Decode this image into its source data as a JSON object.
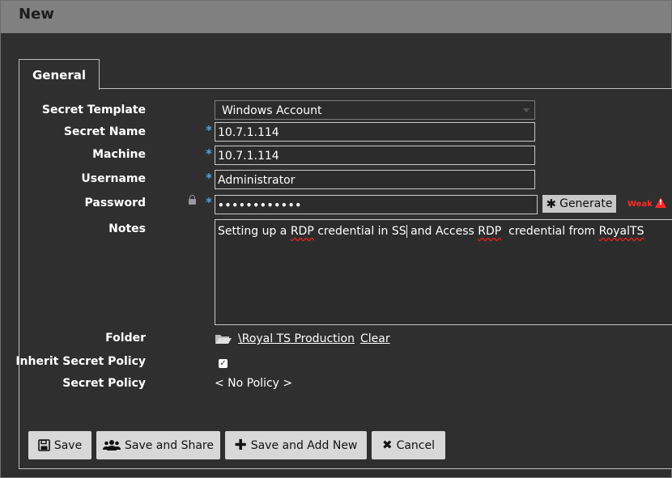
{
  "window": {
    "title": "New"
  },
  "tabs": [
    {
      "label": "General"
    }
  ],
  "form": {
    "secret_template": {
      "label": "Secret Template",
      "value": "Windows Account"
    },
    "secret_name": {
      "label": "Secret Name",
      "value": "10.7.1.114",
      "required": "*"
    },
    "machine": {
      "label": "Machine",
      "value": "10.7.1.114",
      "required": "*"
    },
    "username": {
      "label": "Username",
      "value": "Administrator",
      "required": "*"
    },
    "password": {
      "label": "Password",
      "value": "••••••••••••",
      "required": "*",
      "generate_label": "Generate",
      "strength": "Weak"
    },
    "notes": {
      "label": "Notes",
      "part1": "Setting up a ",
      "rdp1": "RDP",
      "part2": " credential in SS",
      "part3": " and Access ",
      "rdp2": "RDP",
      "part4": "  credential from ",
      "royalts": "RoyalTS"
    },
    "folder": {
      "label": "Folder",
      "value": "\\Royal TS Production",
      "clear_label": "Clear"
    },
    "inherit_secret_policy": {
      "label": "Inherit Secret Policy",
      "checked": true
    },
    "secret_policy": {
      "label": "Secret Policy",
      "value": "< No Policy >"
    }
  },
  "buttons": {
    "save": "Save",
    "save_and_share": "Save and Share",
    "save_and_add_new": "Save and Add New",
    "cancel": "Cancel"
  },
  "colors": {
    "background": "#2f2f2f",
    "titlebar": "#808080",
    "required": "#5aa0d8",
    "weak": "#ff2a2a",
    "button": "#d8d8d8"
  },
  "icons": {
    "generate": "asterisk-icon",
    "save": "floppy-disk-icon",
    "share": "users-icon",
    "add": "plus-icon",
    "cancel": "x-icon",
    "folder": "folder-open-icon",
    "lock": "lock-icon",
    "warning": "warning-icon"
  }
}
